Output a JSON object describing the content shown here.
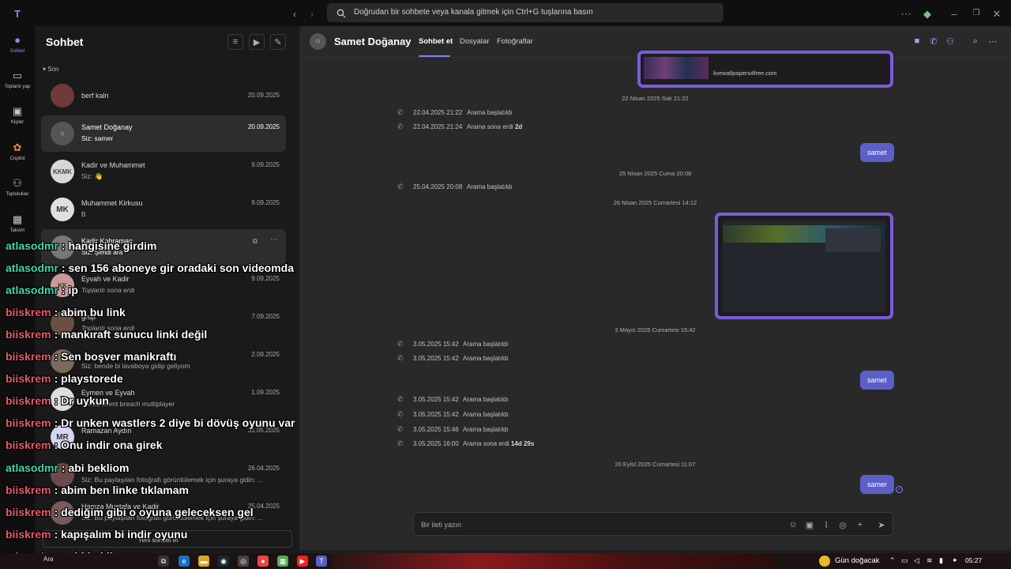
{
  "topbar": {
    "search_placeholder": "Doğrudan bir sohbete veya kanala gitmek için Ctrl+G tuşlarına basın"
  },
  "rail": [
    {
      "label": "Sohbet",
      "icon": "chat-icon"
    },
    {
      "label": "Toplantı yap",
      "icon": "meet-icon"
    },
    {
      "label": "Kişiler",
      "icon": "people-icon"
    },
    {
      "label": "Copilot",
      "icon": "copilot-icon"
    },
    {
      "label": "Topluluklar",
      "icon": "communities-icon"
    },
    {
      "label": "Takvim",
      "icon": "calendar-icon"
    }
  ],
  "list": {
    "title": "Sohbet",
    "section": "Son",
    "chats": [
      {
        "name": "berf kaln",
        "sub": "",
        "date": "20.09.2025",
        "initials": ""
      },
      {
        "name": "Samet Doğanay",
        "sub": "Siz: samer",
        "date": "20.09.2025",
        "initials": ""
      },
      {
        "name": "Kadir ve Muhammet",
        "sub": "Siz: 👋",
        "date": "9.09.2025",
        "initials": "KKMK"
      },
      {
        "name": "Muhammet Kirkusu",
        "sub": "B",
        "date": "9.09.2025",
        "initials": "MK"
      },
      {
        "name": "Kadir Kahraman",
        "sub": "Siz: Şimdi ara",
        "date": "",
        "initials": ""
      },
      {
        "name": "Eyvah ve Kadir",
        "sub": "Toplantı sona erdi",
        "date": "9.09.2025",
        "initials": "KK"
      },
      {
        "name": "grup",
        "sub": "Toplantı sona erdi",
        "date": "7.09.2025",
        "initials": ""
      },
      {
        "name": "",
        "sub": "Siz: bende bi lavaboya gidip geliyom",
        "date": "2.09.2025",
        "initials": ""
      },
      {
        "name": "Eymen ve Eyvah",
        "sub": "containment breach multiplayer",
        "date": "1.09.2025",
        "initials": "T"
      },
      {
        "name": "Ramazan Aydın",
        "sub": "",
        "date": "31.05.2025",
        "initials": "MR"
      },
      {
        "name": "",
        "sub": "Siz: Bu paylaşılan fotoğrafı görüntülemek için şuraya gidin: ...",
        "date": "26.04.2025",
        "initials": ""
      },
      {
        "name": "Hamza Mustafa ve Kadir",
        "sub": "Siz: Bu paylaşılan fotoğrafı görüntülemek için şuraya gidin: ...",
        "date": "25.04.2025",
        "initials": ""
      }
    ],
    "new_chat_label": "Yeni sohbet et"
  },
  "chat": {
    "name": "Samet Doğanay",
    "tabs": [
      "Sohbet et",
      "Dosyalar",
      "Fotoğraflar"
    ],
    "link_url": "livewallpapers4free.com",
    "messages": [
      {
        "kind": "date",
        "text": "22 Nisan 2025 Salı 21:22"
      },
      {
        "kind": "call",
        "time": "22.04.2025 21:22",
        "text": "Arama başlatıldı",
        "dur": ""
      },
      {
        "kind": "call",
        "time": "22.04.2025 21:24",
        "text": "Arama sona erdi",
        "dur": "2d"
      },
      {
        "kind": "bubble",
        "text": "samet"
      },
      {
        "kind": "date",
        "text": "25 Nisan 2025 Cuma 20:08"
      },
      {
        "kind": "call",
        "time": "25.04.2025 20:08",
        "text": "Arama başlatıldı",
        "dur": ""
      },
      {
        "kind": "date",
        "text": "26 Nisan 2025 Cumartesi 14:12"
      },
      {
        "kind": "date",
        "text": "3 Mayıs 2025 Cumartesi 15:42"
      },
      {
        "kind": "call",
        "time": "3.05.2025 15:42",
        "text": "Arama başlatıldı",
        "dur": ""
      },
      {
        "kind": "call",
        "time": "3.05.2025 15:42",
        "text": "Arama başlatıldı",
        "dur": ""
      },
      {
        "kind": "bubble",
        "text": "samet"
      },
      {
        "kind": "call",
        "time": "3.05.2025 15:42",
        "text": "Arama başlatıldı",
        "dur": ""
      },
      {
        "kind": "call",
        "time": "3.05.2025 15:42",
        "text": "Arama başlatıldı",
        "dur": ""
      },
      {
        "kind": "call",
        "time": "3.05.2025 15:46",
        "text": "Arama başlatıldı",
        "dur": ""
      },
      {
        "kind": "call",
        "time": "3.05.2025 16:00",
        "text": "Arama sona erdi",
        "dur": "14d 29s"
      },
      {
        "kind": "date",
        "text": "20 Eylül 2025 Cumartesi 11:07"
      },
      {
        "kind": "bubble",
        "text": "samer"
      }
    ],
    "composer_placeholder": "Bir ileti yazın"
  },
  "overlay": [
    {
      "user": "atlasodmr",
      "text": ": hangisine girdim",
      "color": "a"
    },
    {
      "user": "atlasodmr",
      "text": ": sen 156 aboneye gir oradaki son videomda",
      "color": "a"
    },
    {
      "user": "atlasodmr",
      "text": ": ip",
      "color": "a"
    },
    {
      "user": "biiskrem",
      "text": ": abim bu link",
      "color": "b"
    },
    {
      "user": "biiskrem",
      "text": ": mankıraft sunucu linki değil",
      "color": "b"
    },
    {
      "user": "biiskrem",
      "text": ": Sen boşver manikraftı",
      "color": "b"
    },
    {
      "user": "biiskrem",
      "text": ": playstorede",
      "color": "b"
    },
    {
      "user": "biiskrem",
      "text": ": Dr uykun",
      "color": "b"
    },
    {
      "user": "biiskrem",
      "text": ": Dr unken wastlers 2 diye bi dövüş oyunu var",
      "color": "b"
    },
    {
      "user": "biiskrem",
      "text": ": Onu indir ona girek",
      "color": "b"
    },
    {
      "user": "atlasodmr",
      "text": ": abi bekliom",
      "color": "a"
    },
    {
      "user": "biiskrem",
      "text": ": abim ben linke tıklamam",
      "color": "b"
    },
    {
      "user": "biiskrem",
      "text": ": dediğim gibi o oyuna geleceksen gel",
      "color": "b"
    },
    {
      "user": "biiskrem",
      "text": ": kapışalım bi indir oyunu",
      "color": "b"
    },
    {
      "user": "atlasodmr",
      "text": ": abi bekliom",
      "color": "a"
    }
  ],
  "taskbar": {
    "search_label": "Ara",
    "weather": "Gün doğacak",
    "time": "05:27"
  }
}
